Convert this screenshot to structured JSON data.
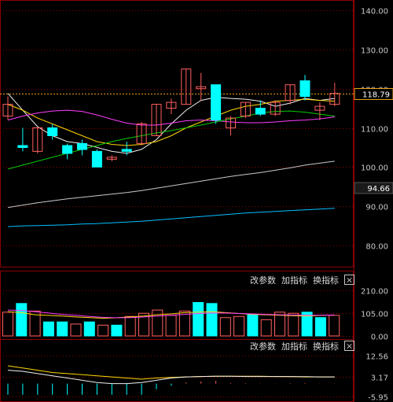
{
  "colors": {
    "up": "#ff5f5f",
    "down": "#00ffff",
    "ma5": "#f0f0f0",
    "ma10": "#ffd700",
    "ma20": "#ff3cff",
    "ma30": "#00cc00",
    "ma60": "#c8c8c8",
    "ma120": "#00bfff",
    "grid": "#8b0000",
    "price_line": "#e8a317",
    "sub_line1": "#ffd700",
    "sub_line2": "#f0f0f0"
  },
  "controls": {
    "params_label": "改参数",
    "add_indicator_label": "加指标",
    "switch_indicator_label": "换指标",
    "close_glyph": "×"
  },
  "chart_data": [
    {
      "type": "candlestick",
      "panel": "price",
      "ylim": [
        75,
        142
      ],
      "y_ticks": [
        "140.00",
        "130.00",
        "120.00",
        "110.00",
        "100.00",
        "90.00",
        "80.00"
      ],
      "y_tick_values": [
        140,
        130,
        120,
        110,
        100,
        90,
        80
      ],
      "last_price_tag": "118.79",
      "mid_tag": "94.66",
      "candles": [
        {
          "o": 113,
          "h": 118,
          "l": 112,
          "c": 116
        },
        {
          "o": 105.5,
          "h": 110,
          "l": 104,
          "c": 105
        },
        {
          "o": 104,
          "h": 110,
          "l": 103.5,
          "c": 110
        },
        {
          "o": 110,
          "h": 111,
          "l": 107,
          "c": 108
        },
        {
          "o": 105.5,
          "h": 106,
          "l": 102,
          "c": 103.5
        },
        {
          "o": 106,
          "h": 107,
          "l": 103,
          "c": 104.5
        },
        {
          "o": 104,
          "h": 104.5,
          "l": 100,
          "c": 100
        },
        {
          "o": 102,
          "h": 103,
          "l": 101.5,
          "c": 102.5
        },
        {
          "o": 104.5,
          "h": 106.5,
          "l": 103,
          "c": 104
        },
        {
          "o": 106,
          "h": 111.5,
          "l": 105.5,
          "c": 111
        },
        {
          "o": 108,
          "h": 116,
          "l": 108,
          "c": 116
        },
        {
          "o": 115,
          "h": 117.5,
          "l": 113.5,
          "c": 116.5
        },
        {
          "o": 116,
          "h": 125,
          "l": 116,
          "c": 125
        },
        {
          "o": 120,
          "h": 124,
          "l": 117,
          "c": 120.5
        },
        {
          "o": 121,
          "h": 121,
          "l": 111,
          "c": 112
        },
        {
          "o": 110,
          "h": 113,
          "l": 108,
          "c": 112.5
        },
        {
          "o": 113,
          "h": 116.5,
          "l": 112.5,
          "c": 116.5
        },
        {
          "o": 115,
          "h": 117,
          "l": 113,
          "c": 113.5
        },
        {
          "o": 113.5,
          "h": 117,
          "l": 113,
          "c": 116.5
        },
        {
          "o": 117,
          "h": 121,
          "l": 116,
          "c": 121
        },
        {
          "o": 122,
          "h": 123.5,
          "l": 117,
          "c": 118
        },
        {
          "o": 114.5,
          "h": 116.5,
          "l": 112,
          "c": 115.5
        },
        {
          "o": 116,
          "h": 121.5,
          "l": 115.5,
          "c": 118.79
        }
      ],
      "ma_lines": [
        {
          "key": "ma5",
          "values": [
            118.8,
            114.5,
            110.3,
            108.0,
            106.5,
            106.0,
            105.0,
            104.0,
            103.5,
            104.5,
            107.0,
            111.0,
            114.5,
            117.0,
            117.8,
            117.5,
            117.3,
            116.8,
            115.5,
            116.3,
            117.5,
            117.0,
            117.5
          ]
        },
        {
          "key": "ma10",
          "values": [
            116.0,
            114.5,
            112.5,
            111.0,
            109.5,
            108.0,
            106.5,
            105.8,
            105.5,
            105.8,
            106.5,
            108.0,
            110.0,
            111.5,
            113.0,
            114.5,
            115.5,
            116.0,
            116.8,
            117.0,
            117.3,
            117.0,
            116.8
          ]
        },
        {
          "key": "ma20",
          "values": [
            112.0,
            113.0,
            113.8,
            114.3,
            114.5,
            114.2,
            113.3,
            112.2,
            111.2,
            110.7,
            110.7,
            111.2,
            111.8,
            112.0,
            111.8,
            111.5,
            111.3,
            111.3,
            111.5,
            111.8,
            112.0,
            112.3,
            112.8
          ]
        },
        {
          "key": "ma30",
          "values": [
            99.5,
            100.5,
            101.5,
            102.5,
            103.5,
            104.5,
            105.5,
            106.5,
            107.3,
            108.0,
            108.7,
            109.3,
            110.0,
            110.7,
            111.5,
            112.3,
            113.0,
            113.8,
            114.2,
            114.3,
            114.0,
            113.5,
            113.0
          ]
        },
        {
          "key": "ma60",
          "values": [
            89.7,
            90.3,
            90.9,
            91.4,
            91.9,
            92.3,
            92.7,
            93.1,
            93.5,
            94.0,
            94.6,
            95.2,
            95.8,
            96.4,
            97.0,
            97.6,
            98.1,
            98.6,
            99.2,
            99.8,
            100.5,
            101.0,
            101.5
          ]
        },
        {
          "key": "ma120",
          "values": [
            84.8,
            85.0,
            85.1,
            85.2,
            85.3,
            85.5,
            85.6,
            85.8,
            86.0,
            86.2,
            86.5,
            86.8,
            87.1,
            87.4,
            87.7,
            88.0,
            88.3,
            88.5,
            88.7,
            88.9,
            89.1,
            89.3,
            89.5
          ]
        }
      ]
    },
    {
      "type": "bar",
      "panel": "indicator-1",
      "ylim": [
        0,
        215
      ],
      "y_ticks": [
        "210.00",
        "105.00",
        "0.00"
      ],
      "y_tick_values": [
        210,
        105,
        0
      ],
      "values": [
        110,
        150,
        115,
        65,
        65,
        55,
        65,
        50,
        50,
        90,
        105,
        120,
        95,
        115,
        155,
        150,
        85,
        90,
        100,
        75,
        110,
        105,
        110,
        85,
        95
      ],
      "directions": [
        "up",
        "down",
        "up",
        "down",
        "down",
        "up",
        "down",
        "up",
        "down",
        "up",
        "up",
        "up",
        "up",
        "up",
        "down",
        "down",
        "up",
        "up",
        "down",
        "up",
        "up",
        "up",
        "down",
        "down",
        "up"
      ],
      "lines": [
        {
          "key": "sub_line1",
          "values": [
            112,
            108,
            98,
            95,
            92,
            88,
            85,
            82,
            84,
            88,
            92,
            98,
            102,
            108,
            110,
            112,
            108,
            104,
            100,
            98,
            96,
            94,
            92,
            95,
            97
          ]
        },
        {
          "key": "ma20",
          "values": [
            120,
            118,
            112,
            106,
            100,
            95,
            90,
            86,
            84,
            85,
            88,
            92,
            96,
            100,
            104,
            106,
            106,
            104,
            102,
            100,
            98,
            97,
            96,
            96,
            97
          ]
        }
      ]
    },
    {
      "type": "bar",
      "panel": "indicator-2",
      "ylim": [
        -6.5,
        14
      ],
      "y_ticks": [
        "12.56",
        "3.17",
        "-5.95"
      ],
      "y_tick_values": [
        12.56,
        3.17,
        -5.95
      ],
      "values": [
        -5,
        -5,
        -5,
        -5,
        -5,
        -5,
        -5,
        -5,
        -5,
        -5,
        -2.5,
        -1,
        0.5,
        1,
        1.2,
        0.3,
        0.2,
        0.1,
        0.1,
        0.2,
        0.3,
        0.1,
        0.1
      ],
      "lines": [
        {
          "key": "sub_line1",
          "values": [
            8,
            7,
            6,
            5,
            4.5,
            4,
            3.5,
            3,
            2.5,
            2,
            2.5,
            2.8,
            3,
            3.2,
            3.3,
            3.3,
            3.3,
            3.3,
            3.2,
            3.1,
            3,
            3,
            3
          ]
        },
        {
          "key": "sub_line2",
          "values": [
            6,
            5.5,
            4.5,
            3.5,
            2.5,
            1.5,
            0.5,
            0,
            0,
            0.5,
            1.5,
            2.5,
            3,
            3.2,
            3.3,
            3.3,
            3.2,
            3.2,
            3.2,
            3.2,
            3.1,
            3,
            3
          ]
        }
      ]
    }
  ]
}
